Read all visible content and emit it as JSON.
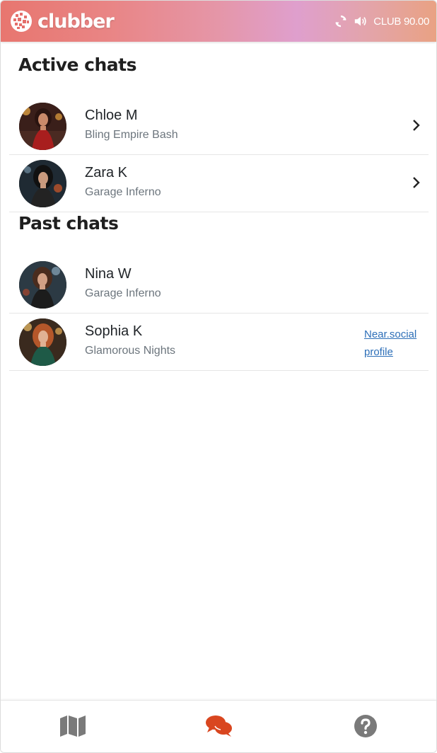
{
  "app": {
    "name": "clubber",
    "balance": "CLUB 90.00",
    "icons": {
      "logo": "disco-ball-icon",
      "refresh": "refresh-icon",
      "sound": "volume-icon"
    }
  },
  "active_chats": {
    "title": "Active chats",
    "items": [
      {
        "name": "Chloe M",
        "event": "Bling Empire Bash",
        "action": "chevron-right-icon"
      },
      {
        "name": "Zara K",
        "event": "Garage Inferno",
        "action": "chevron-right-icon"
      }
    ]
  },
  "past_chats": {
    "title": "Past chats",
    "items": [
      {
        "name": "Nina W",
        "event": "Garage Inferno"
      },
      {
        "name": "Sophia K",
        "event": "Glamorous Nights",
        "link": "Near.social profile"
      }
    ]
  },
  "bottom_nav": {
    "items": [
      {
        "icon": "map-icon",
        "active": false
      },
      {
        "icon": "chat-icon",
        "active": true
      },
      {
        "icon": "help-icon",
        "active": false
      }
    ],
    "colors": {
      "active": "#d9461f",
      "inactive": "#7a7a7a"
    }
  },
  "colors": {
    "header_gradient": [
      "#e8766f",
      "#df9fcd",
      "#e9a283"
    ],
    "link": "#2d6fb8",
    "muted_text": "#6c757d"
  }
}
